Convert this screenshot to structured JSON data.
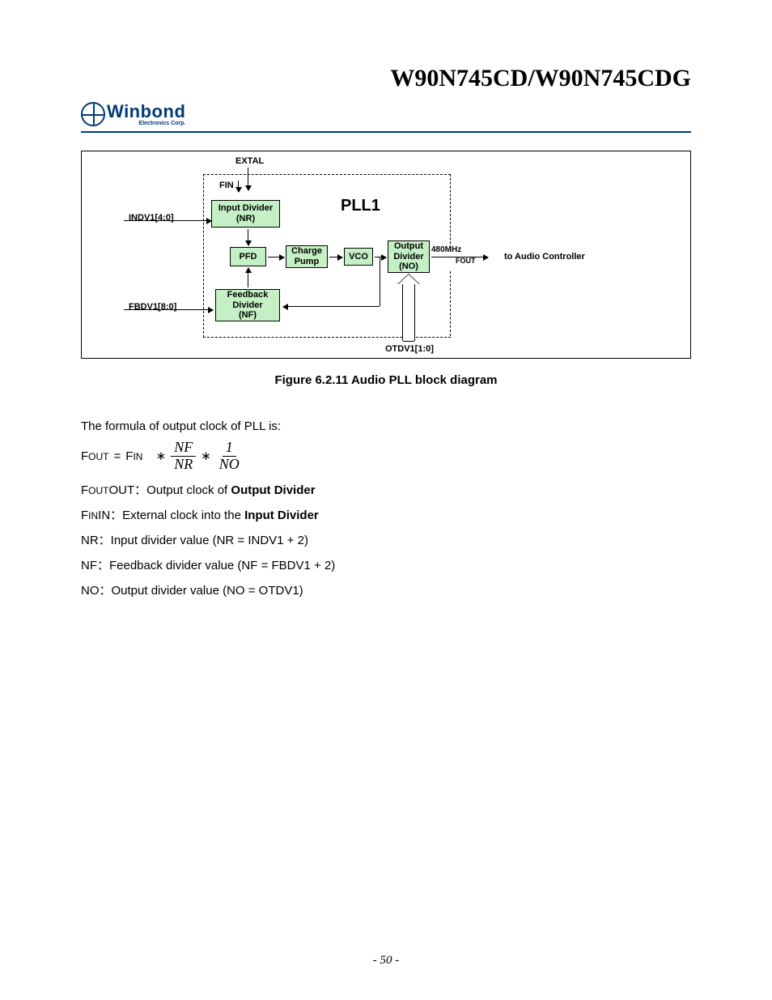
{
  "header": {
    "title": "W90N745CD/W90N745CDG",
    "logo_main": "Winbond",
    "logo_sub": "Electronics Corp."
  },
  "diagram": {
    "extal": "EXTAL",
    "fin": "FIN",
    "indv": "INDV1[4:0]",
    "fbdv": "FBDV1[8:0]",
    "otdv": "OTDV1[1:0]",
    "pll": "PLL1",
    "freq": "480MHz",
    "fout": "FOUT",
    "to_audio": "to Audio Controller",
    "input_div_l1": "Input Divider",
    "input_div_l2": "(NR)",
    "pfd": "PFD",
    "charge_l1": "Charge",
    "charge_l2": "Pump",
    "vco": "VCO",
    "output_l1": "Output",
    "output_l2": "Divider",
    "output_l3": "(NO)",
    "fb_l1": "Feedback",
    "fb_l2": "Divider",
    "fb_l3": "(NF)"
  },
  "caption": "Figure 6.2.11 Audio PLL block diagram",
  "body": {
    "intro": "The formula of output clock of PLL is:",
    "fout": "OUT",
    "fin": "IN",
    "f": "F",
    "eq": "=",
    "star": "∗",
    "nf": "NF",
    "nr": "NR",
    "one": "1",
    "no": "NO",
    "def_fout_pre": "OUT：Output clock of ",
    "def_fout_b": "Output Divider",
    "def_fin_pre": "IN：External clock into the ",
    "def_fin_b": "Input Divider",
    "def_nr": "NR：Input divider value (NR = INDV1 + 2)",
    "def_nf": "NF：Feedback divider value (NF = FBDV1 + 2)",
    "def_no": "NO：Output divider value (NO = OTDV1)"
  },
  "pagenum": "- 50 -"
}
